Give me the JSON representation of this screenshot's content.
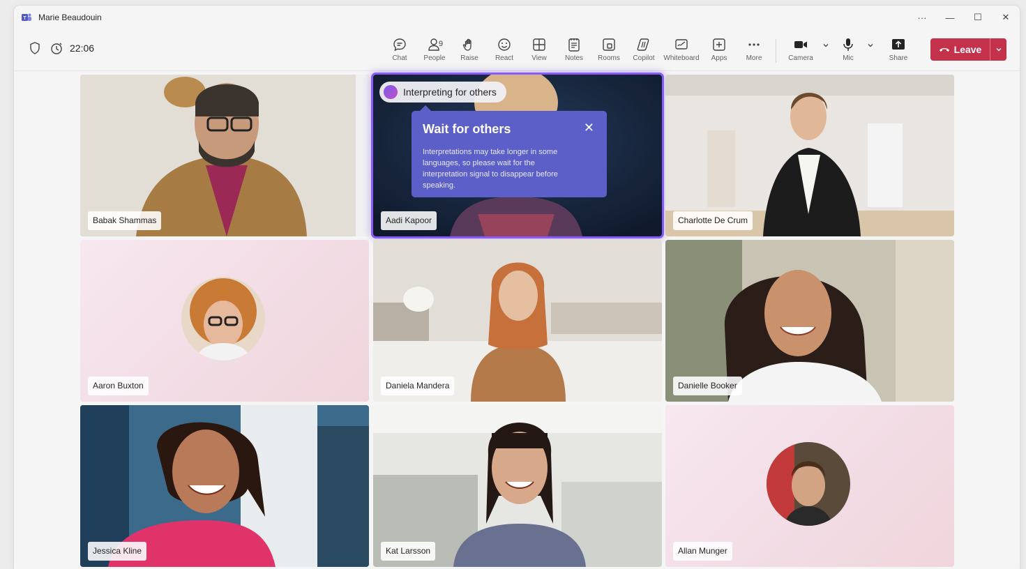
{
  "window": {
    "title": "Marie Beaudouin",
    "controls": [
      "···",
      "—",
      "☐",
      "✕"
    ]
  },
  "toolbar": {
    "timer": "22:06",
    "buttons": [
      {
        "id": "chat",
        "label": "Chat",
        "icon": "chat-icon"
      },
      {
        "id": "people",
        "label": "People",
        "icon": "people-icon",
        "badge": "9"
      },
      {
        "id": "raise",
        "label": "Raise",
        "icon": "hand-icon"
      },
      {
        "id": "react",
        "label": "React",
        "icon": "smile-icon"
      },
      {
        "id": "view",
        "label": "View",
        "icon": "grid-icon"
      },
      {
        "id": "notes",
        "label": "Notes",
        "icon": "notes-icon"
      },
      {
        "id": "rooms",
        "label": "Rooms",
        "icon": "rooms-icon"
      },
      {
        "id": "copilot",
        "label": "Copilot",
        "icon": "copilot-icon"
      },
      {
        "id": "whiteboard",
        "label": "Whiteboard",
        "icon": "whiteboard-icon"
      },
      {
        "id": "apps",
        "label": "Apps",
        "icon": "apps-icon"
      },
      {
        "id": "more",
        "label": "More",
        "icon": "more-icon"
      }
    ],
    "camera_label": "Camera",
    "mic_label": "Mic",
    "share_label": "Share",
    "leave_label": "Leave"
  },
  "interpreting": {
    "pill_text": "Interpreting for others"
  },
  "callout": {
    "title": "Wait for others",
    "body": "Interpretations may take longer in some languages, so please wait for the interpretation signal to disappear before speaking."
  },
  "participants": [
    {
      "name": "Babak Shammas"
    },
    {
      "name": "Aadi Kapoor"
    },
    {
      "name": "Charlotte De Crum"
    },
    {
      "name": "Aaron Buxton"
    },
    {
      "name": "Daniela Mandera"
    },
    {
      "name": "Danielle Booker"
    },
    {
      "name": "Jessica Kline"
    },
    {
      "name": "Kat Larsson"
    },
    {
      "name": "Allan Munger"
    }
  ],
  "colors": {
    "leave": "#c4314b",
    "accent": "#5b5fc7",
    "highlight": "#8a5cf6"
  }
}
